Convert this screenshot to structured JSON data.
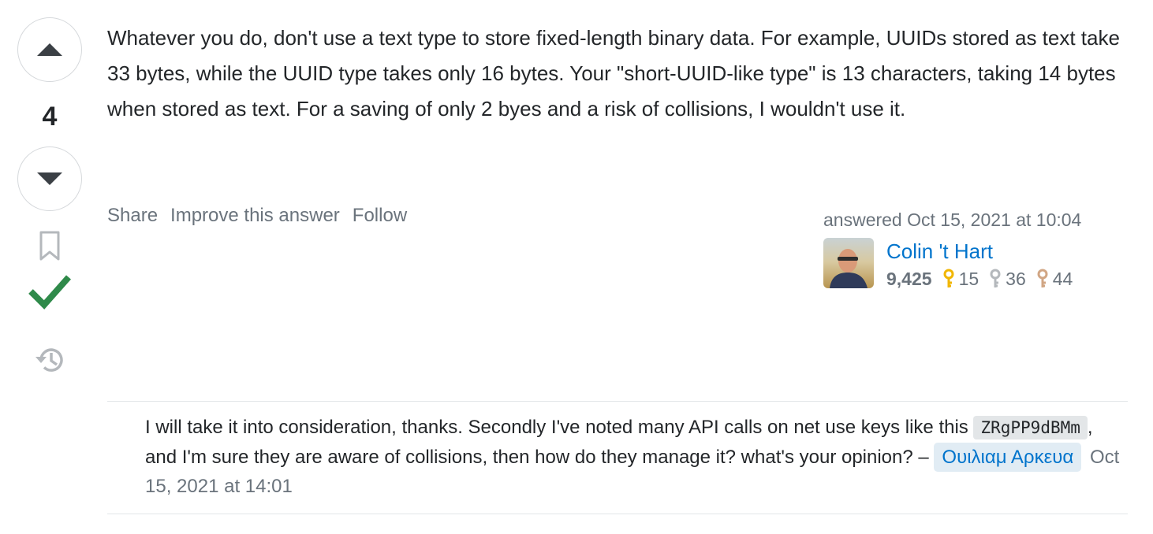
{
  "vote": {
    "count": "4",
    "up_icon": "triangle-up-icon",
    "down_icon": "triangle-down-icon",
    "accepted_color": "#2f8a4a"
  },
  "answer": {
    "text": "Whatever you do, don't use a text type to store fixed-length binary data. For example, UUIDs stored as text take 33 bytes, while the UUID type takes only 16 bytes. Your \"short-UUID-like type\" is 13 characters, taking 14 bytes when stored as text. For a saving of only 2 byes and a risk of collisions, I wouldn't use it."
  },
  "menu": {
    "share": "Share",
    "improve": "Improve this answer",
    "follow": "Follow"
  },
  "signature": {
    "action": "answered Oct 15, 2021 at 10:04",
    "name": "Colin 't Hart",
    "reputation": "9,425",
    "gold": "15",
    "silver": "36",
    "bronze": "44",
    "gold_color": "#f1b600",
    "silver_color": "#b4b8bc",
    "bronze_color": "#d1a684"
  },
  "comment": {
    "text_before": "I will take it into consideration, thanks. Secondly I've noted many API calls on net use keys like this ",
    "code": "ZRgPP9dBMm",
    "text_after": ", and I'm sure they are aware of collisions, then how do they manage it? what's your opinion? – ",
    "user": "Ουιλιαμ Αρκευα",
    "date": "Oct 15, 2021 at 14:01"
  }
}
